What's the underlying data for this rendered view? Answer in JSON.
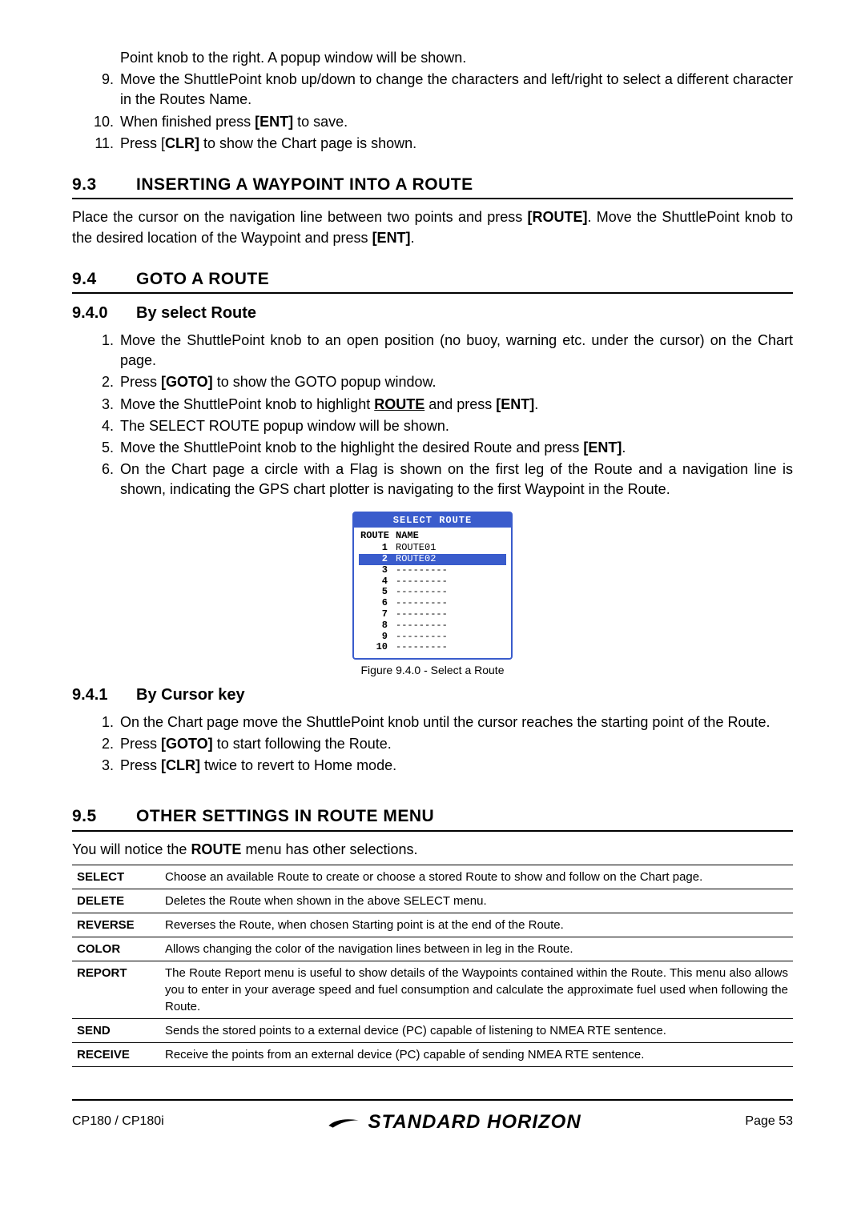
{
  "intro_list": [
    {
      "num": "",
      "text": "Point knob to the right. A popup window will be shown.",
      "indent": true
    },
    {
      "num": "9.",
      "text": "Move the ShuttlePoint knob up/down to change the characters and left/right to select a different character in the Routes Name."
    },
    {
      "num": "10.",
      "text_html": "When finished press <b>[ENT]</b> to save."
    },
    {
      "num": "11.",
      "text_html": "Press [<b>CLR]</b> to show the Chart page is shown."
    }
  ],
  "sec93": {
    "num": "9.3",
    "title": "INSERTING A WAYPOINT INTO A ROUTE",
    "para_html": "Place the cursor on the navigation line between two points and press <b>[ROUTE]</b>. Move the ShuttlePoint knob to the desired location of the Waypoint and press <b>[ENT]</b>."
  },
  "sec94": {
    "num": "9.4",
    "title": "GOTO A ROUTE"
  },
  "sec940": {
    "num": "9.4.0",
    "title": "By select Route",
    "items": [
      {
        "num": "1.",
        "text": "Move the ShuttlePoint knob to an open position (no buoy, warning etc. under the cursor) on the Chart page."
      },
      {
        "num": "2.",
        "text_html": "Press <b>[GOTO]</b> to show the GOTO popup window."
      },
      {
        "num": "3.",
        "text_html": "Move the ShuttlePoint knob to highlight <span class=\"route-link\">ROUTE</span> and press <b>[ENT]</b>."
      },
      {
        "num": "4.",
        "text": "The SELECT ROUTE popup window will be shown."
      },
      {
        "num": "5.",
        "text_html": "Move the ShuttlePoint knob to the highlight the desired Route and press <b>[ENT]</b>."
      },
      {
        "num": "6.",
        "text": "On the Chart page a circle with a Flag is shown on the first leg of the Route and a navigation line is shown, indicating the GPS chart plotter is navigating to the first Waypoint in the Route."
      }
    ]
  },
  "figure": {
    "title": "SELECT ROUTE",
    "col_route": "ROUTE",
    "col_name": "NAME",
    "rows": [
      {
        "r": "1",
        "n": "ROUTE01",
        "sel": false
      },
      {
        "r": "2",
        "n": "ROUTE02",
        "sel": true
      },
      {
        "r": "3",
        "n": "---------",
        "sel": false
      },
      {
        "r": "4",
        "n": "---------",
        "sel": false
      },
      {
        "r": "5",
        "n": "---------",
        "sel": false
      },
      {
        "r": "6",
        "n": "---------",
        "sel": false
      },
      {
        "r": "7",
        "n": "---------",
        "sel": false
      },
      {
        "r": "8",
        "n": "---------",
        "sel": false
      },
      {
        "r": "9",
        "n": "---------",
        "sel": false
      },
      {
        "r": "10",
        "n": "---------",
        "sel": false
      }
    ],
    "caption": "Figure 9.4.0 -  Select a Route"
  },
  "sec941": {
    "num": "9.4.1",
    "title": "By Cursor key",
    "items": [
      {
        "num": "1.",
        "text": "On the Chart page move the ShuttlePoint knob until the cursor reaches the starting point of the Route."
      },
      {
        "num": "2.",
        "text_html": "Press <b>[GOTO]</b> to start following the Route."
      },
      {
        "num": "3.",
        "text_html": "Press <b>[CLR]</b> twice to revert to Home mode."
      }
    ]
  },
  "sec95": {
    "num": "9.5",
    "title": "OTHER SETTINGS IN ROUTE MENU",
    "para_html": "You will notice the <b>ROUTE</b> menu has other selections.",
    "rows": [
      {
        "k": "SELECT",
        "v": "Choose an available Route to create or choose a stored Route to show and follow on the Chart page."
      },
      {
        "k": "DELETE",
        "v": "Deletes the Route when shown in the above SELECT menu."
      },
      {
        "k": "REVERSE",
        "v": "Reverses the Route, when chosen Starting point is at the end of the Route."
      },
      {
        "k": "COLOR",
        "v": "Allows changing the color of the navigation lines between in leg in the Route."
      },
      {
        "k": "REPORT",
        "v": "The Route Report menu is useful to show details of the Waypoints contained within the Route. This menu also allows you to enter in your average speed and fuel consumption and calculate the approximate fuel used when following the Route."
      },
      {
        "k": "SEND",
        "v": "Sends the stored points to a external device (PC) capable of listening to NMEA RTE sentence."
      },
      {
        "k": "RECEIVE",
        "v": "Receive the points from an external device (PC) capable of sending NMEA RTE sentence."
      }
    ]
  },
  "footer": {
    "model": "CP180 / CP180i",
    "brand": "STANDARD HORIZON",
    "page": "Page 53"
  }
}
